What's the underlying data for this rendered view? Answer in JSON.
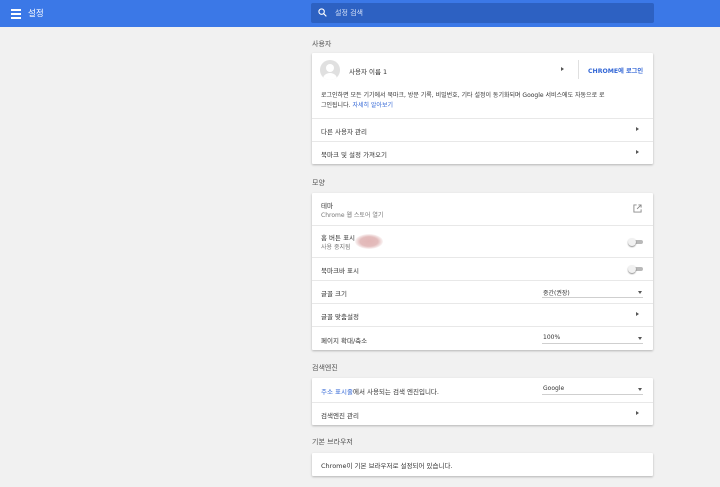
{
  "header": {
    "title": "설정",
    "search_placeholder": "설정 검색"
  },
  "people": {
    "section_title": "사용자",
    "user_name": "사용자 이름 1",
    "signin_button": "CHROME에 로그인",
    "signin_desc_prefix": "로그인하면 모든 기기에서 북마크, 방문 기록, 비밀번호, 기타 설정이 동기화되며 Google 서비스에도 자동으로 로",
    "signin_desc_suffix": "그인됩니다.",
    "learn_more": "자세히 알아보기",
    "manage_users": "다른 사용자 관리",
    "import_bookmarks": "북마크 및 설정 가져오기"
  },
  "appearance": {
    "section_title": "모양",
    "theme_label": "테마",
    "theme_sub": "Chrome 웹 스토어 열기",
    "home_label": "홈 버튼 표시",
    "home_sub": "사용 중지됨",
    "bookmarks_bar_label": "북마크바 표시",
    "font_size_label": "글꼴 크기",
    "font_size_value": "중간(권장)",
    "customize_fonts_label": "글꼴 맞춤설정",
    "zoom_label": "페이지 확대/축소",
    "zoom_value": "100%"
  },
  "search_engine": {
    "section_title": "검색엔진",
    "address_bar_link": "주소 표시줄",
    "address_bar_rest": "에서 사용되는 검색 엔진입니다.",
    "engine_value": "Google",
    "manage_label": "검색엔진 관리"
  },
  "default_browser": {
    "section_title": "기본 브라우저",
    "status_text": "Chrome이 기본 브라우저로 설정되어 있습니다."
  },
  "colors": {
    "topbar": "#3b78e7",
    "search_bg": "#2d61c2",
    "link": "#3367d6",
    "background": "#f1f1f1"
  }
}
